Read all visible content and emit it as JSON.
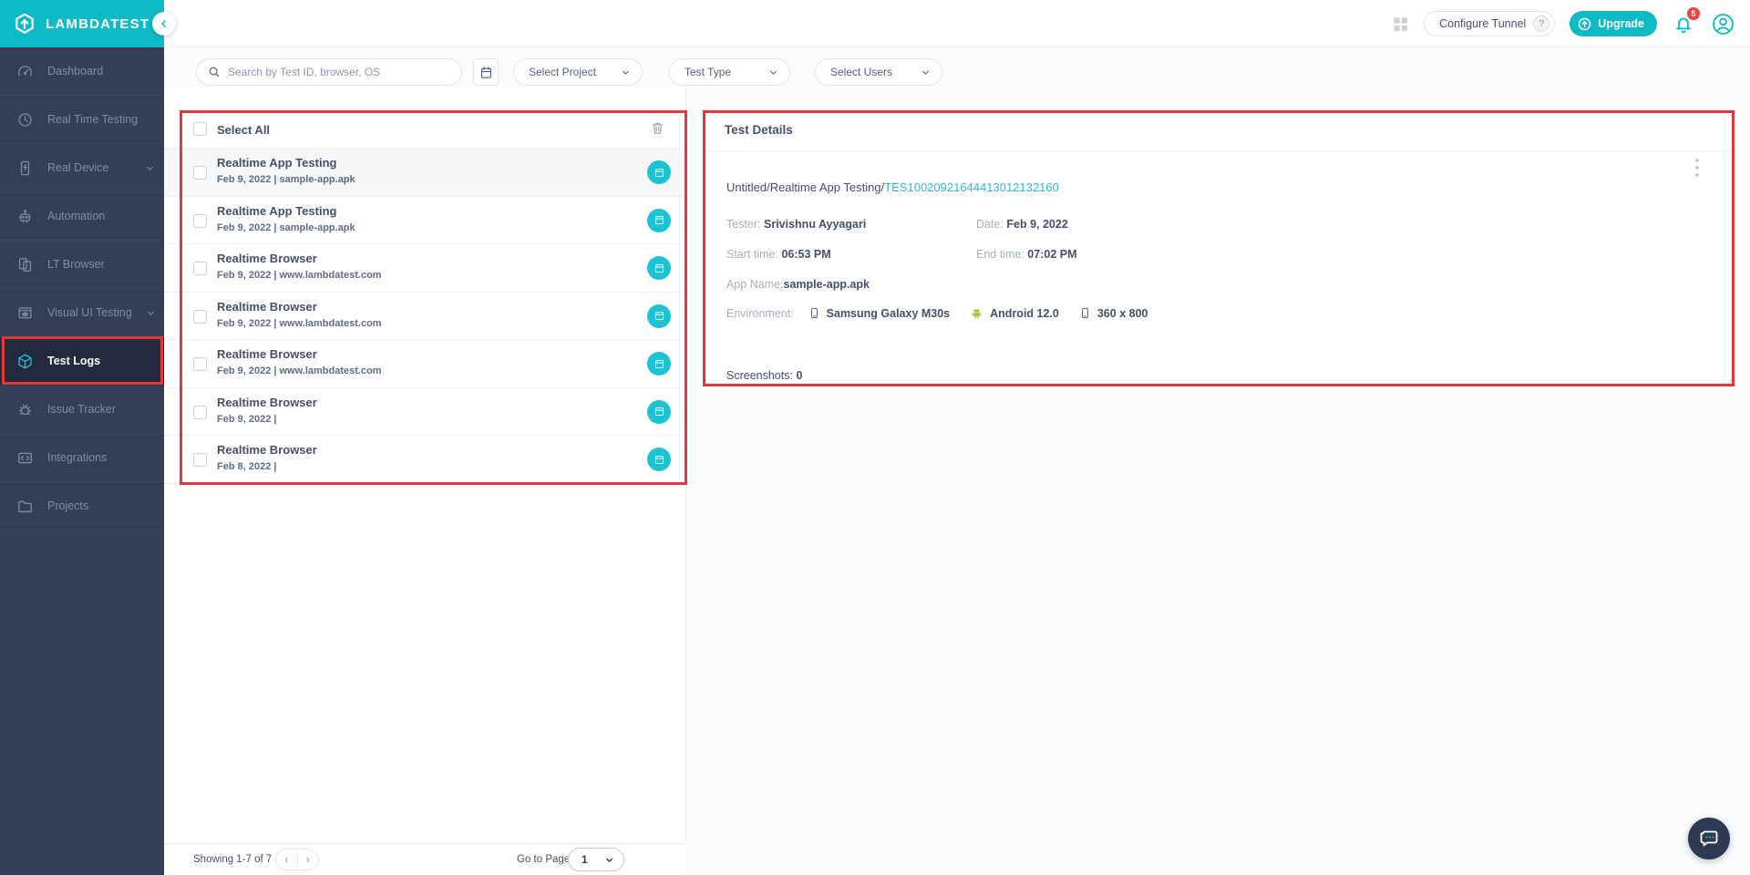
{
  "colors": {
    "brand_teal": "#0ebac5",
    "list_icon_teal": "#1cc3d2",
    "link_teal": "#2fb9d4",
    "sidebar_navy": "#353e57",
    "annotation_red": "#e23838",
    "android_green": "#9ec73d",
    "badge_red": "#e8453c"
  },
  "brand": {
    "logo_text": "LAMBDATEST"
  },
  "topbar": {
    "configure_tunnel_label": "Configure Tunnel",
    "help_glyph": "?",
    "upgrade_label": "Upgrade",
    "notification_count": "5"
  },
  "sidebar": {
    "items": [
      {
        "label": "Dashboard"
      },
      {
        "label": "Real Time Testing"
      },
      {
        "label": "Real Device"
      },
      {
        "label": "Automation"
      },
      {
        "label": "LT Browser"
      },
      {
        "label": "Visual UI Testing"
      },
      {
        "label": "Test Logs"
      },
      {
        "label": "Issue Tracker"
      },
      {
        "label": "Integrations"
      },
      {
        "label": "Projects"
      }
    ]
  },
  "filters": {
    "search_placeholder": "Search by Test ID, browser, OS",
    "project_label": "Select Project",
    "test_type_label": "Test Type",
    "users_label": "Select Users"
  },
  "test_list": {
    "select_all_label": "Select All",
    "rows": [
      {
        "title": "Realtime App Testing",
        "subtitle": "Feb 9, 2022 | sample-app.apk"
      },
      {
        "title": "Realtime App Testing",
        "subtitle": "Feb 9, 2022 | sample-app.apk"
      },
      {
        "title": "Realtime Browser",
        "subtitle": "Feb 9, 2022 | www.lambdatest.com"
      },
      {
        "title": "Realtime Browser",
        "subtitle": "Feb 9, 2022 | www.lambdatest.com"
      },
      {
        "title": "Realtime Browser",
        "subtitle": "Feb 9, 2022 | www.lambdatest.com"
      },
      {
        "title": "Realtime Browser",
        "subtitle": "Feb 9, 2022 |"
      },
      {
        "title": "Realtime Browser",
        "subtitle": "Feb 8, 2022 |"
      }
    ]
  },
  "pagination": {
    "showing": "Showing 1-7 of 7",
    "prev_glyph": "‹",
    "next_glyph": "›",
    "go_to_page_label": "Go to Page :",
    "page_value": "1"
  },
  "details": {
    "title": "Test Details",
    "breadcrumb_prefix": "Untitled/Realtime App Testing/",
    "test_id": "TES10020921644413012132160",
    "tester_label": "Tester:",
    "tester": "Srivishnu Ayyagari",
    "date_label": "Date:",
    "date": "Feb 9, 2022",
    "start_label": "Start time:",
    "start": "06:53 PM",
    "end_label": "End time:",
    "end": "07:02 PM",
    "app_label": "App Name:",
    "app": "sample-app.apk",
    "env_label": "Environment:",
    "device": "Samsung Galaxy M30s",
    "os": "Android 12.0",
    "resolution": "360 x 800",
    "screenshots_label": "Screenshots:",
    "screenshots": "0"
  }
}
